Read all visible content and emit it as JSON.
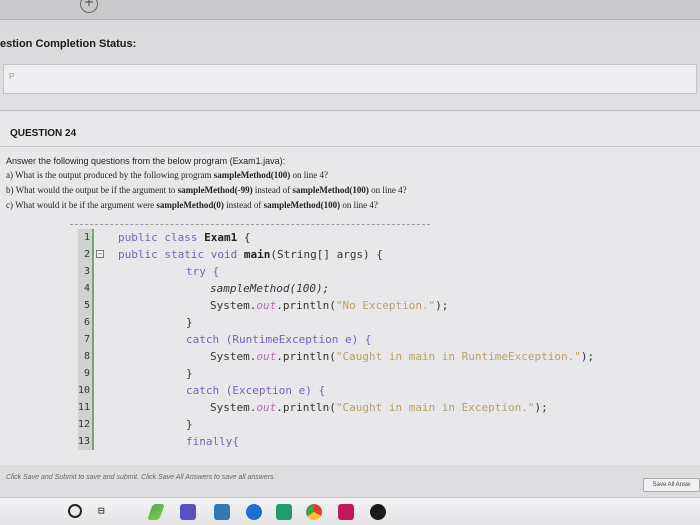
{
  "header": {
    "status_label": "estion Completion Status:",
    "status_placeholder": "P"
  },
  "question": {
    "title": "QUESTION 24",
    "intro": "Answer the following questions from the below program (Exam1.java):",
    "parts": [
      {
        "pre": "a) What is the output produced by the following program ",
        "bold": "sampleMethod(100)",
        "post": " on line 4?"
      },
      {
        "pre": "b) What would the output be if the argument to ",
        "bold": "sampleMethod(-99)",
        "mid": " instead of ",
        "bold2": "sampleMethod(100)",
        "post": " on line 4?"
      },
      {
        "pre": "c) What would it be if the argument were ",
        "bold": "sampleMethod(0)",
        "mid": " instead of ",
        "bold2": "sampleMethod(100)",
        "post": " on line 4?"
      }
    ]
  },
  "code": {
    "line_numbers": [
      "1",
      "2",
      "3",
      "4",
      "5",
      "6",
      "7",
      "8",
      "9",
      "10",
      "11",
      "12",
      "13"
    ],
    "line1_kw": "public class ",
    "line1_name": "Exam1",
    "line1_end": " {",
    "line2_kw": "public static void ",
    "line2_name": "main",
    "line2_end": "(String[] args) {",
    "line3": "try {",
    "line4": "sampleMethod(100);",
    "line5_a": "System.",
    "line5_out": "out",
    "line5_b": ".println(",
    "line5_str": "\"No Exception.\"",
    "line5_c": ");",
    "line6": "}",
    "line7": "catch (RuntimeException e) {",
    "line8_a": "System.",
    "line8_out": "out",
    "line8_b": ".println(",
    "line8_str": "\"Caught in main in RuntimeException.\"",
    "line8_c": ");",
    "line9": "}",
    "line10": "catch (Exception e) {",
    "line11_a": "System.",
    "line11_out": "out",
    "line11_b": ".println(",
    "line11_str": "\"Caught in main in Exception.\"",
    "line11_c": ");",
    "line12": "}",
    "line13": "finally{"
  },
  "footer": {
    "note": "Click Save and Submit to save and submit. Click Save All Answers to save all answers.",
    "save_all_label": "Save All Answ"
  },
  "colors": {
    "keyword": "#7a5fb8",
    "string": "#b8a06a",
    "field": "#b06fb0",
    "gutter_accent": "#72a872"
  }
}
